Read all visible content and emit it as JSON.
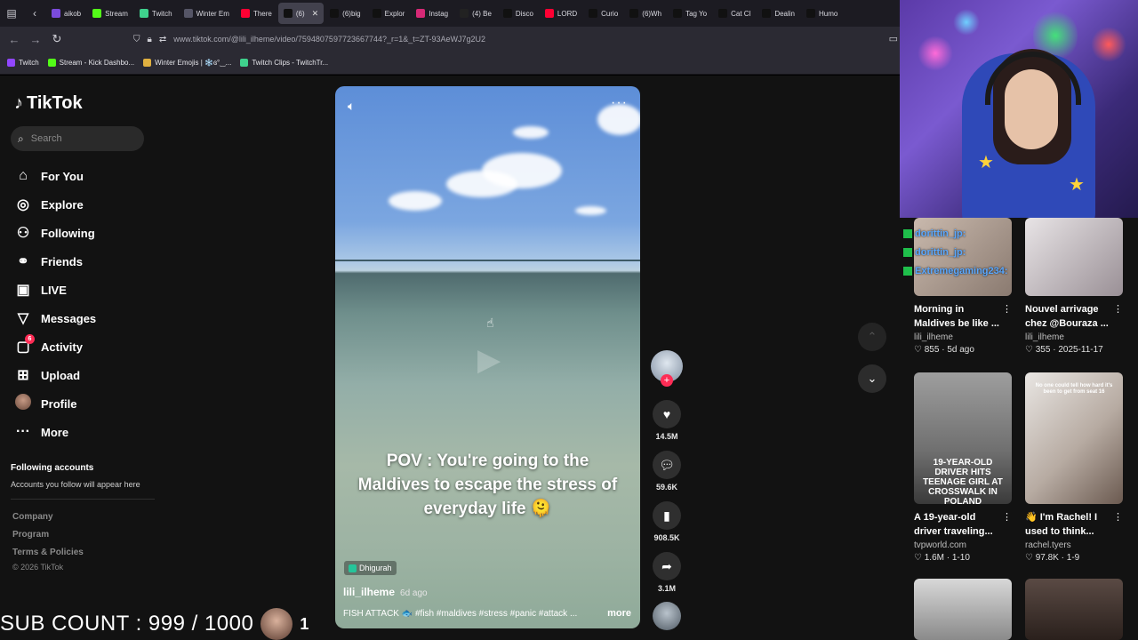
{
  "browser": {
    "tabs": [
      {
        "label": "aikob",
        "color": "#7b4bdc"
      },
      {
        "label": "Stream",
        "color": "#53fc18"
      },
      {
        "label": "Twitch",
        "color": "#3fd18d"
      },
      {
        "label": "Winter Em",
        "color": "#555566"
      },
      {
        "label": "There",
        "color": "#ff0033"
      },
      {
        "label": "(6)",
        "color": "#111111",
        "active": true
      },
      {
        "label": "(6)big",
        "color": "#111111"
      },
      {
        "label": "Explor",
        "color": "#111111"
      },
      {
        "label": "Instag",
        "color": "#d62976"
      },
      {
        "label": "(4) Be",
        "color": "#222222"
      },
      {
        "label": "Disco",
        "color": "#111111"
      },
      {
        "label": "LORD",
        "color": "#ff0033"
      },
      {
        "label": "Curio",
        "color": "#111111"
      },
      {
        "label": "(6)Wh",
        "color": "#111111"
      },
      {
        "label": "Tag Yo",
        "color": "#111111"
      },
      {
        "label": "Cat Cl",
        "color": "#111111"
      },
      {
        "label": "Dealin",
        "color": "#111111"
      },
      {
        "label": "Humo",
        "color": "#111111"
      }
    ],
    "url": "www.tiktok.com/@lili_ilheme/video/7594807597723667744?_r=1&_t=ZT-93AeWJ7g2U2",
    "bookmarks": [
      {
        "label": "Twitch",
        "color": "#9146ff"
      },
      {
        "label": "Stream - Kick Dashbo...",
        "color": "#53fc18"
      },
      {
        "label": "Winter Emojis | ❄️ɞ°‿...",
        "color": "#e0b040"
      },
      {
        "label": "Twitch Clips - TwitchTr...",
        "color": "#3fd18d"
      }
    ]
  },
  "tiktok": {
    "logo": "TikTok",
    "search_placeholder": "Search",
    "nav": [
      {
        "label": "For You",
        "icon": "home-icon",
        "glyph": "⌂"
      },
      {
        "label": "Explore",
        "icon": "compass-icon",
        "glyph": "◎"
      },
      {
        "label": "Following",
        "icon": "user-check-icon",
        "glyph": "⚇"
      },
      {
        "label": "Friends",
        "icon": "friends-icon",
        "glyph": "⚭"
      },
      {
        "label": "LIVE",
        "icon": "live-icon",
        "glyph": "▣"
      },
      {
        "label": "Messages",
        "icon": "send-icon",
        "glyph": "▽"
      },
      {
        "label": "Activity",
        "icon": "activity-icon",
        "glyph": "▢",
        "badge": "6"
      },
      {
        "label": "Upload",
        "icon": "upload-icon",
        "glyph": "⊞"
      },
      {
        "label": "Profile",
        "icon": "avatar-icon",
        "glyph": ""
      },
      {
        "label": "More",
        "icon": "more-icon",
        "glyph": "···"
      }
    ],
    "following_heading": "Following accounts",
    "following_sub": "Accounts you follow will appear here",
    "footer": [
      "Company",
      "Program",
      "Terms & Policies"
    ],
    "copyright": "© 2026 TikTok"
  },
  "video": {
    "caption": "POV : You're going to the Maldives to escape the stress of everyday life 🫠",
    "location": "Dhigurah",
    "author": "lili_ilheme",
    "posted": "6d ago",
    "description": "FISH ATTACK 🐟 #fish #maldives #stress #panic #attack ...",
    "more": "more",
    "likes": "14.5M",
    "comments": "59.6K",
    "saves": "908.5K",
    "shares": "3.1M"
  },
  "overlay": {
    "chat": [
      "dorittin_jp:",
      "dorittin_jp:",
      "Extremegaming234:"
    ],
    "cards": [
      {
        "title": "Morning in Maldives be like ...",
        "author": "lili_ilheme",
        "meta": "♡ 855 · 5d ago"
      },
      {
        "title": "Nouvel arrivage chez @Bouraza ...",
        "author": "lili_ilheme",
        "meta": "♡ 355 · 2025-11-17"
      },
      {
        "title": "A 19-year-old driver traveling...",
        "author": "tvpworld.com",
        "meta": "♡ 1.6M · 1-10",
        "thumb_text": "19-YEAR-OLD DRIVER HITS TEENAGE GIRL AT CROSSWALK IN POLAND"
      },
      {
        "title": "👋 I'm Rachel! I used to think...",
        "author": "rachel.tyers",
        "meta": "♡ 97.8K · 1-9",
        "thumb_text": "No one could tell how hard it's been to get from seat 16"
      }
    ],
    "sub_count": "SUB COUNT : 999 / 1000",
    "sub_badge": "1"
  }
}
